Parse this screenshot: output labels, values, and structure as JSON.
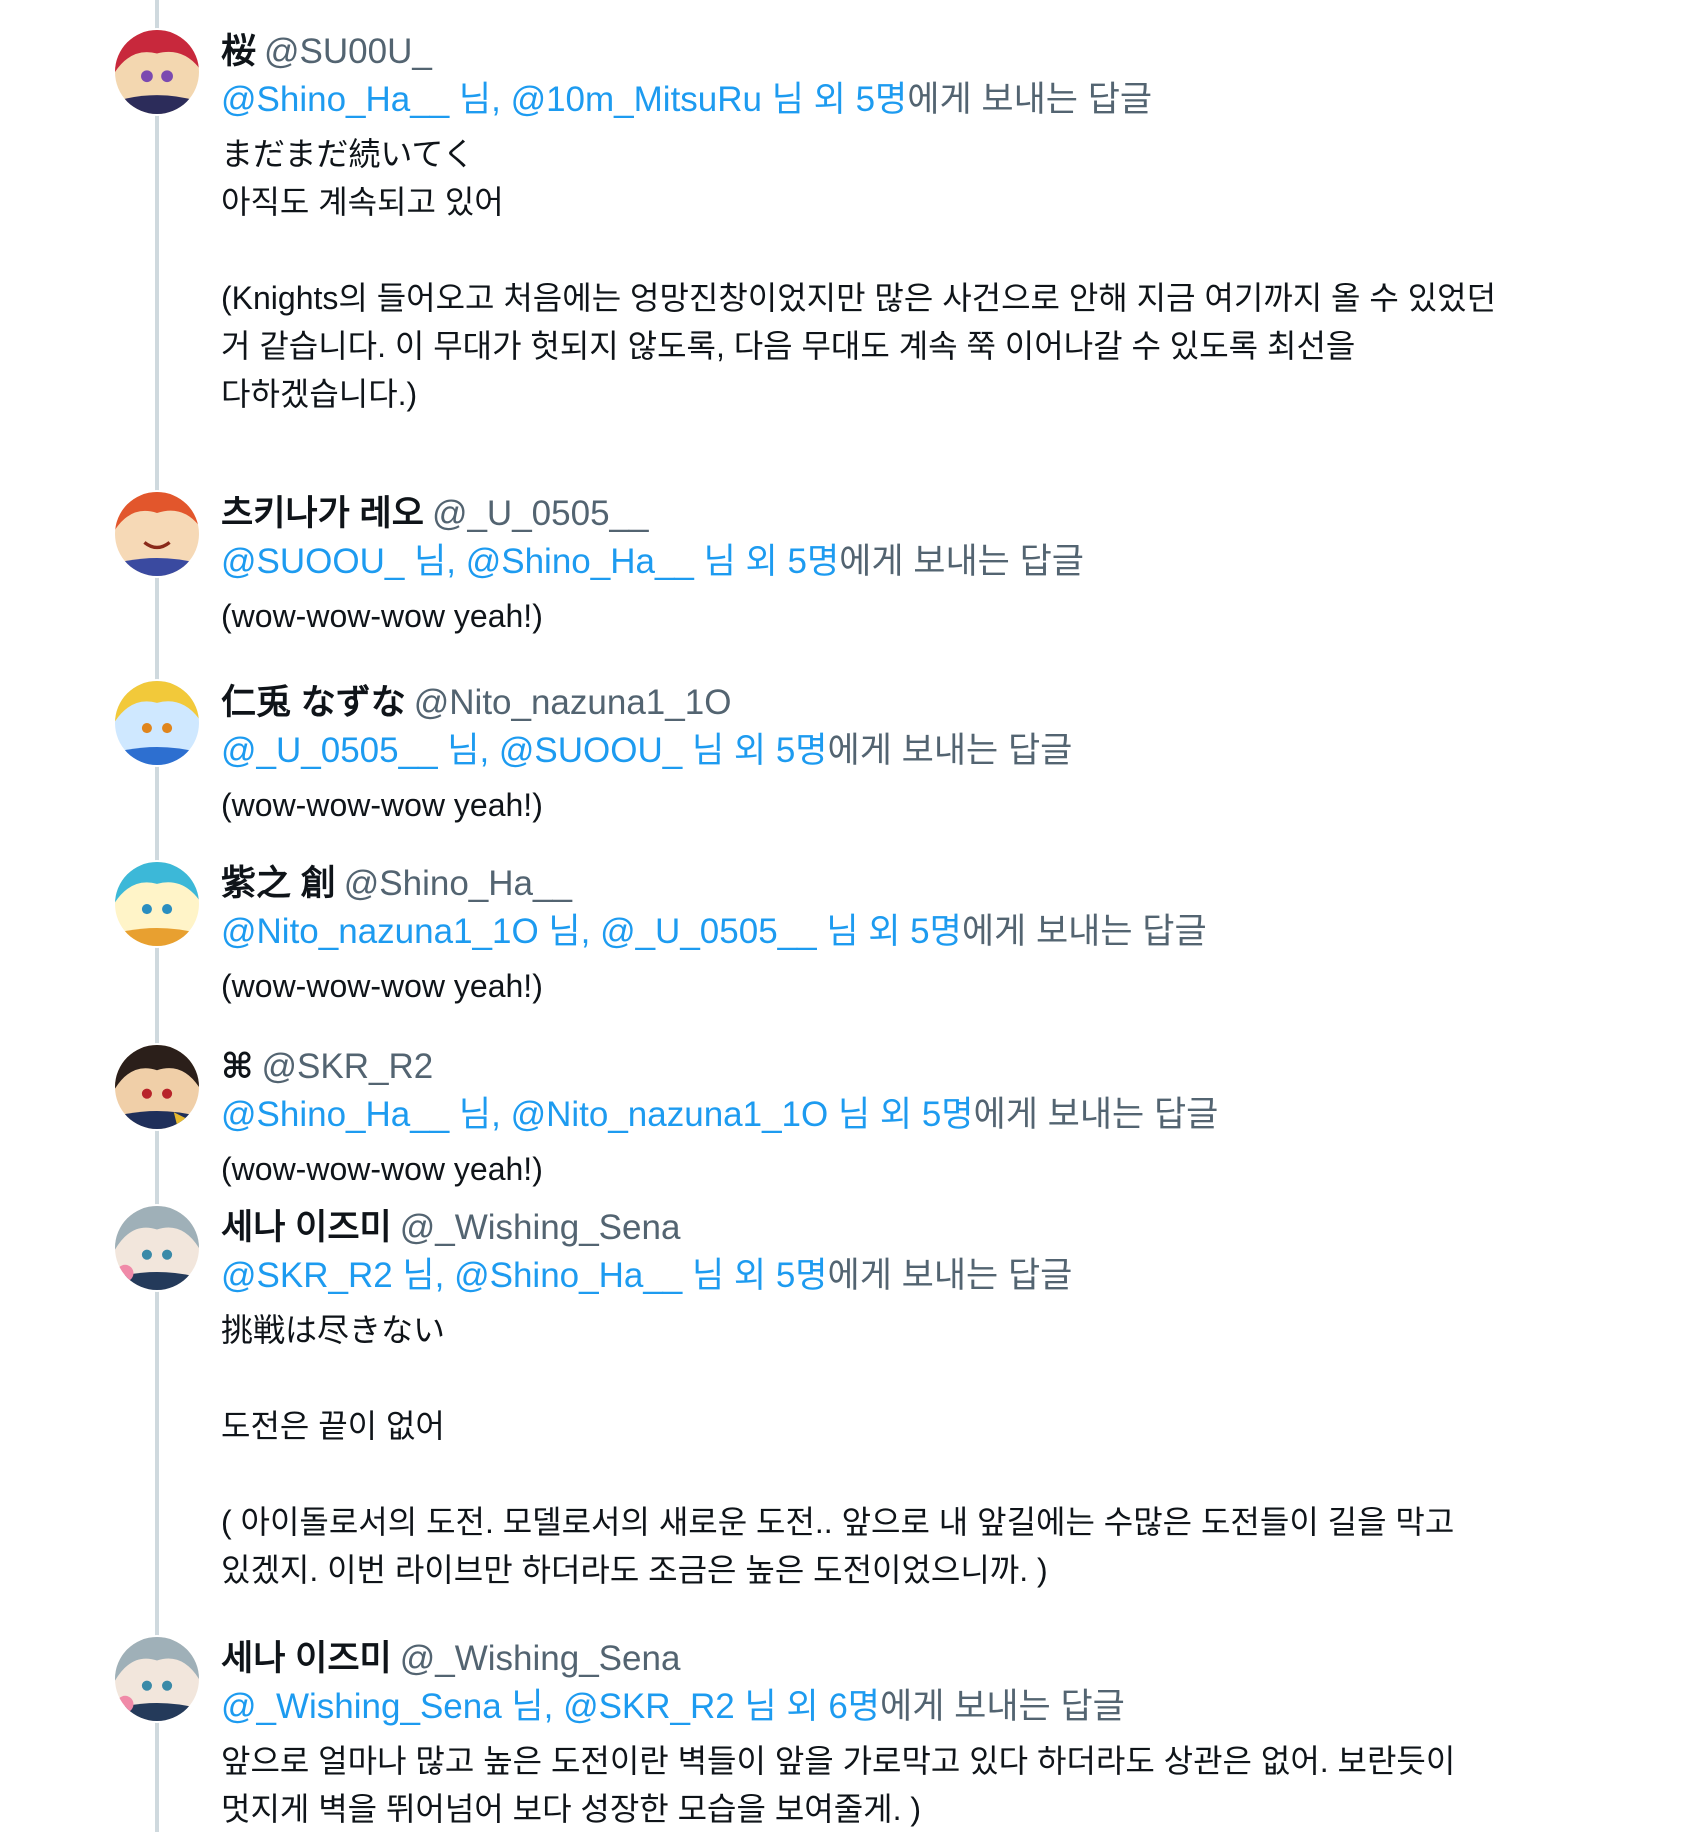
{
  "tweets": [
    {
      "name": "桜",
      "handle": "@SU00U_",
      "reply": {
        "m1": "@Shino_Ha__",
        "s1": " 님, ",
        "m2": "@10m_MitsuRu",
        "s2": " 님 외 5명",
        "tail": "에게 보내는 답글"
      },
      "text": "まだまだ続いてく\n아직도 계속되고 있어\n\n(Knights의 들어오고 처음에는 엉망진창이었지만 많은 사건으로 안해 지금 여기까지 올 수 있었던\n거 같습니다. 이 무대가 헛되지 않도록, 다음 무대도 계속 쭉 이어나갈 수 있도록 최선을\n다하겠습니다.)"
    },
    {
      "name": "츠키나가 레오",
      "handle": "@_U_0505__",
      "reply": {
        "m1": "@SUOOU_",
        "s1": " 님, ",
        "m2": "@Shino_Ha__",
        "s2": " 님 외 5명",
        "tail": "에게 보내는 답글"
      },
      "text": "(wow-wow-wow yeah!)"
    },
    {
      "name": "仁兎 なずな",
      "handle": "@Nito_nazuna1_1O",
      "reply": {
        "m1": "@_U_0505__",
        "s1": " 님, ",
        "m2": "@SUOOU_",
        "s2": " 님 외 5명",
        "tail": "에게 보내는 답글"
      },
      "text": "(wow-wow-wow yeah!)"
    },
    {
      "name": "紫之 創",
      "handle": "@Shino_Ha__",
      "reply": {
        "m1": "@Nito_nazuna1_1O",
        "s1": " 님, ",
        "m2": "@_U_0505__",
        "s2": " 님 외 5명",
        "tail": "에게 보내는 답글"
      },
      "text": "(wow-wow-wow yeah!)"
    },
    {
      "name": "⌘",
      "handle": "@SKR_R2",
      "reply": {
        "m1": "@Shino_Ha__",
        "s1": " 님, ",
        "m2": "@Nito_nazuna1_1O",
        "s2": " 님 외 5명",
        "tail": "에게 보내는 답글"
      },
      "text": "(wow-wow-wow yeah!)"
    },
    {
      "name": "세나 이즈미",
      "handle": "@_Wishing_Sena",
      "reply": {
        "m1": "@SKR_R2",
        "s1": " 님, ",
        "m2": "@Shino_Ha__",
        "s2": " 님 외 5명",
        "tail": "에게 보내는 답글"
      },
      "text": "挑戦は尽きない\n\n도전은 끝이 없어\n\n( 아이돌로서의 도전. 모델로서의 새로운 도전.. 앞으로 내 앞길에는 수많은 도전들이 길을 막고\n있겠지. 이번 라이브만 하더라도 조금은 높은 도전이었으니까. )"
    },
    {
      "name": "세나 이즈미",
      "handle": "@_Wishing_Sena",
      "reply": {
        "m1": "@_Wishing_Sena",
        "s1": " 님, ",
        "m2": "@SKR_R2",
        "s2": " 님 외 6명",
        "tail": "에게 보내는 답글"
      },
      "text": "앞으로 얼마나 많고 높은 도전이란 벽들이 앞을 가로막고 있다 하더라도 상관은 없어. 보란듯이\n멋지게 벽을 뛰어넘어 보다 성장한 모습을 보여줄게. )"
    }
  ]
}
